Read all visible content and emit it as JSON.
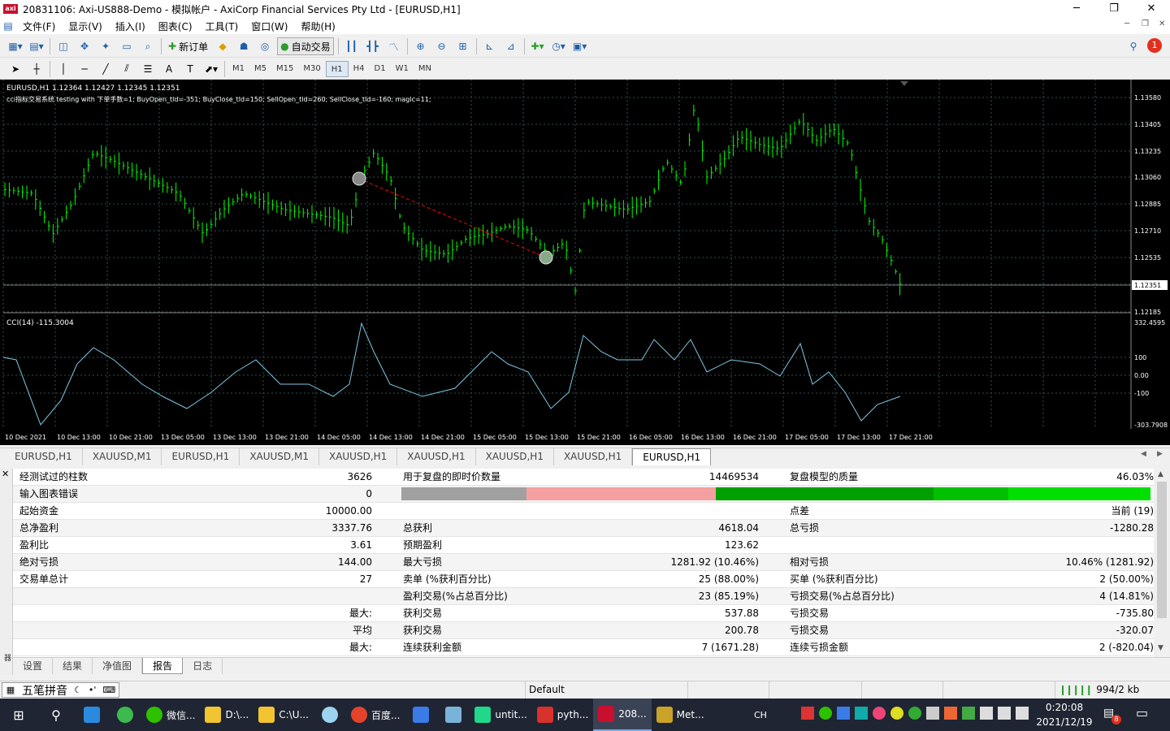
{
  "window": {
    "title": "20831106: Axi-US888-Demo - 模拟帐户 - AxiCorp Financial Services Pty Ltd - [EURUSD,H1]",
    "logo": "axi",
    "minimize": "─",
    "maximize": "❐",
    "close": "✕"
  },
  "menu": [
    "文件(F)",
    "显示(V)",
    "插入(I)",
    "图表(C)",
    "工具(T)",
    "窗口(W)",
    "帮助(H)"
  ],
  "toolbar": {
    "new_order": "新订单",
    "auto_trade": "自动交易",
    "timeframes": [
      "M1",
      "M5",
      "M15",
      "M30",
      "H1",
      "H4",
      "D1",
      "W1",
      "MN"
    ],
    "active_timeframe": "H1",
    "notification_count": "1"
  },
  "chart": {
    "header": "EURUSD,H1  1.12364 1.12427 1.12345 1.12351",
    "ea_label": "cci指标交易系统 testing with 下单手数=1; BuyOpen_tld=-351; BuyClose_tld=150; SellOpen_tld=260; SellClose_tld=-160; magic=11;",
    "price_ticks": [
      "1.13580",
      "1.13405",
      "1.13235",
      "1.13060",
      "1.12885",
      "1.12710",
      "1.12535",
      "1.12351",
      "1.12185"
    ],
    "current_price": "1.12351",
    "cci_label": "CCI(14) -115.3004",
    "cci_ticks": [
      "332.4595",
      "100",
      "0.00",
      "-100",
      "-303.7908"
    ],
    "time_ticks": [
      "10 Dec 2021",
      "10 Dec 13:00",
      "10 Dec 21:00",
      "13 Dec 05:00",
      "13 Dec 13:00",
      "13 Dec 21:00",
      "14 Dec 05:00",
      "14 Dec 13:00",
      "14 Dec 21:00",
      "15 Dec 05:00",
      "15 Dec 13:00",
      "15 Dec 21:00",
      "16 Dec 05:00",
      "16 Dec 13:00",
      "16 Dec 21:00",
      "17 Dec 05:00",
      "17 Dec 13:00",
      "17 Dec 21:00"
    ],
    "colors": {
      "bars": "#00ff00",
      "cci": "#7ec8e3",
      "grid": "#2f4f4f",
      "trade_line": "#ff0000",
      "text": "#ffffff"
    }
  },
  "chart_tabs": [
    "EURUSD,H1",
    "XAUUSD,M1",
    "EURUSD,H1",
    "XAUUSD,M1",
    "XAUUSD,H1",
    "XAUUSD,H1",
    "XAUUSD,H1",
    "XAUUSD,H1",
    "EURUSD,H1"
  ],
  "report": {
    "rows": [
      [
        "经测试过的柱数",
        "3626",
        "用于复盘的即时价数量",
        "14469534",
        "复盘模型的质量",
        "46.03%"
      ],
      [
        "输入图表错误",
        "0",
        "",
        "",
        "",
        ""
      ],
      [
        "起始资金",
        "10000.00",
        "",
        "",
        "点差",
        "当前 (19)"
      ],
      [
        "总净盈利",
        "3337.76",
        "总获利",
        "4618.04",
        "总亏损",
        "-1280.28"
      ],
      [
        "盈利比",
        "3.61",
        "预期盈利",
        "123.62",
        "",
        ""
      ],
      [
        "绝对亏损",
        "144.00",
        "最大亏损",
        "1281.92 (10.46%)",
        "相对亏损",
        "10.46% (1281.92)"
      ],
      [
        "交易单总计",
        "27",
        "卖单 (%获利百分比)",
        "25 (88.00%)",
        "买单 (%获利百分比)",
        "2 (50.00%)"
      ],
      [
        "",
        "",
        "盈利交易(%占总百分比)",
        "23 (85.19%)",
        "亏损交易(%占总百分比)",
        "4 (14.81%)"
      ],
      [
        "",
        "最大:",
        "获利交易",
        "537.88",
        "亏损交易",
        "-735.80"
      ],
      [
        "",
        "平均",
        "获利交易",
        "200.78",
        "亏损交易",
        "-320.07"
      ],
      [
        "",
        "最大:",
        "连续获利金额",
        "7 (1671.28)",
        "连续亏损金额",
        "2 (-820.04)"
      ]
    ],
    "quality_colors": [
      "#a0a0a0",
      "#f4a0a0",
      "#00a000",
      "#00c000",
      "#00e000"
    ]
  },
  "bottom_tabs": [
    "设置",
    "结果",
    "净值图",
    "报告",
    "日志"
  ],
  "active_bottom_tab": "报告",
  "side_label": "测试器",
  "status": {
    "ime": "五笔拼音",
    "profile": "Default",
    "memory": "994/2 kb"
  },
  "taskbar": {
    "items": [
      "微信...",
      "D:\\...",
      "C:\\U...",
      "百度...",
      "untit...",
      "pyth...",
      "208...",
      "Met..."
    ],
    "lang": "CH",
    "time": "0:20:08",
    "date": "2021/12/19",
    "notif_count": "8"
  }
}
